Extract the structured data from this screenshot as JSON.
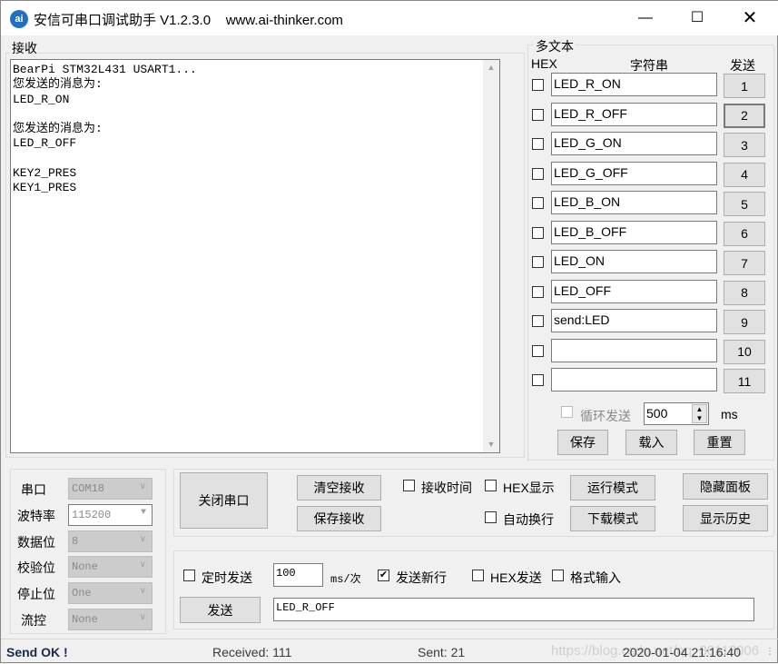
{
  "window": {
    "title": "安信可串口调试助手 V1.2.3.0    www.ai-thinker.com",
    "icon_text": "ai",
    "minimize_icon": "minimize-icon",
    "maximize_icon": "maximize-icon",
    "close_icon": "close-icon"
  },
  "receive": {
    "label": "接收",
    "text": "BearPi STM32L431 USART1...\n您发送的消息为:\nLED_R_ON\n\n您发送的消息为:\nLED_R_OFF\n\nKEY2_PRES\nKEY1_PRES"
  },
  "multi": {
    "label": "多文本",
    "hex_header": "HEX",
    "string_header": "字符串",
    "send_header": "发送",
    "rows": [
      {
        "hex": false,
        "text": "LED_R_ON",
        "btn": "1"
      },
      {
        "hex": false,
        "text": "LED_R_OFF",
        "btn": "2"
      },
      {
        "hex": false,
        "text": "LED_G_ON",
        "btn": "3"
      },
      {
        "hex": false,
        "text": "LED_G_OFF",
        "btn": "4"
      },
      {
        "hex": false,
        "text": "LED_B_ON",
        "btn": "5"
      },
      {
        "hex": false,
        "text": "LED_B_OFF",
        "btn": "6"
      },
      {
        "hex": false,
        "text": "LED_ON",
        "btn": "7"
      },
      {
        "hex": false,
        "text": "LED_OFF",
        "btn": "8"
      },
      {
        "hex": false,
        "text": "send:LED",
        "btn": "9"
      },
      {
        "hex": false,
        "text": "",
        "btn": "10"
      },
      {
        "hex": false,
        "text": "",
        "btn": "11"
      }
    ],
    "loop_label": "循环发送",
    "loop_checked": false,
    "loop_interval": "500",
    "loop_unit": "ms",
    "save": "保存",
    "load": "载入",
    "reset": "重置"
  },
  "serial": {
    "fields": [
      {
        "label": "串口",
        "value": "COM18",
        "enabled": false
      },
      {
        "label": "波特率",
        "value": "115200",
        "enabled": true
      },
      {
        "label": "数据位",
        "value": "8",
        "enabled": false
      },
      {
        "label": "校验位",
        "value": "None",
        "enabled": false
      },
      {
        "label": "停止位",
        "value": "One",
        "enabled": false
      },
      {
        "label": "流控",
        "value": "None",
        "enabled": false
      }
    ]
  },
  "controls": {
    "close_port": "关闭串口",
    "clear_recv": "清空接收",
    "save_recv": "保存接收",
    "recv_time": "接收时间",
    "hex_display": "HEX显示",
    "auto_wrap": "自动换行",
    "run_mode": "运行模式",
    "download_mode": "下载模式",
    "hide_panel": "隐藏面板",
    "show_history": "显示历史"
  },
  "send": {
    "timed_send": "定时发送",
    "timed_checked": false,
    "interval": "100",
    "interval_unit": "ms/次",
    "newline": "发送新行",
    "newline_checked": true,
    "hex_send": "HEX发送",
    "format_input": "格式输入",
    "send_button": "发送",
    "text": "LED_R_OFF"
  },
  "status": {
    "message": "Send OK !",
    "received": "Received: 111",
    "sent": "Sent: 21",
    "datetime": "2020-01-04 21:16:40",
    "watermark": "https://blog.csdn.net/qq_38113006"
  }
}
